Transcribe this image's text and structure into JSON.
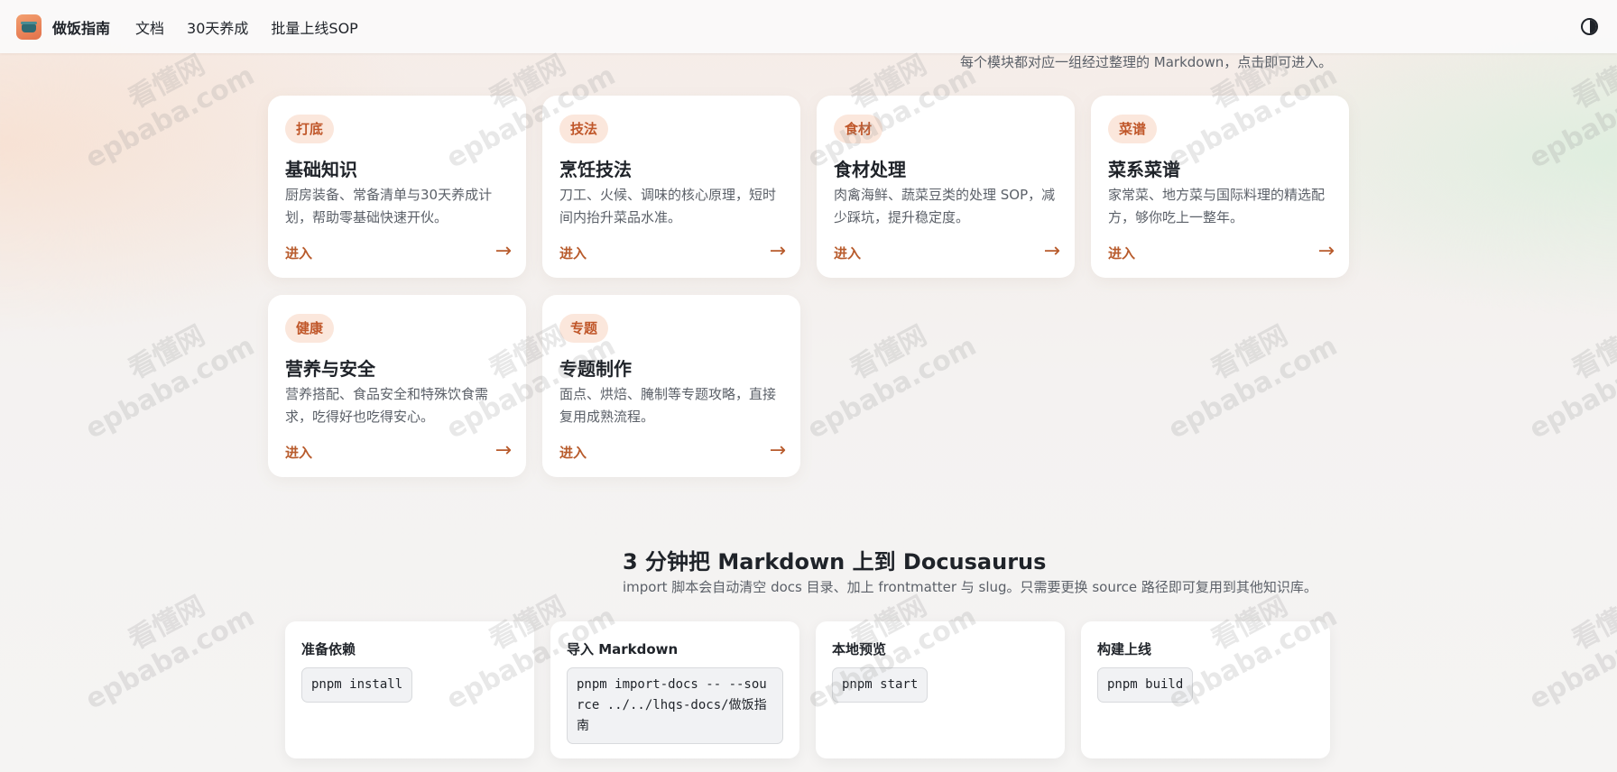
{
  "nav": {
    "brand": "做饭指南",
    "links": [
      "文档",
      "30天养成",
      "批量上线SOP"
    ]
  },
  "intro": "每个模块都对应一组经过整理的 Markdown，点击即可进入。",
  "cards": [
    {
      "tag": "打底",
      "title": "基础知识",
      "desc": "厨房装备、常备清单与30天养成计划，帮助零基础快速开伙。",
      "link": "进入",
      "arrow": "→"
    },
    {
      "tag": "技法",
      "title": "烹饪技法",
      "desc": "刀工、火候、调味的核心原理，短时间内抬升菜品水准。",
      "link": "进入",
      "arrow": "→"
    },
    {
      "tag": "食材",
      "title": "食材处理",
      "desc": "肉禽海鲜、蔬菜豆类的处理 SOP，减少踩坑，提升稳定度。",
      "link": "进入",
      "arrow": "→"
    },
    {
      "tag": "菜谱",
      "title": "菜系菜谱",
      "desc": "家常菜、地方菜与国际料理的精选配方，够你吃上一整年。",
      "link": "进入",
      "arrow": "→"
    },
    {
      "tag": "健康",
      "title": "营养与安全",
      "desc": "营养搭配、食品安全和特殊饮食需求，吃得好也吃得安心。",
      "link": "进入",
      "arrow": "→"
    },
    {
      "tag": "专题",
      "title": "专题制作",
      "desc": "面点、烘焙、腌制等专题攻略，直接复用成熟流程。",
      "link": "进入",
      "arrow": "→"
    }
  ],
  "section": {
    "title": "3 分钟把 Markdown 上到 Docusaurus",
    "subtitle": "import 脚本会自动清空 docs 目录、加上 frontmatter 与 slug。只需要更换 source 路径即可复用到其他知识库。"
  },
  "steps": [
    {
      "title": "准备依赖",
      "code": "pnpm install"
    },
    {
      "title": "导入 Markdown",
      "code": "pnpm import-docs -- --source ../../lhqs-docs/做饭指南"
    },
    {
      "title": "本地预览",
      "code": "pnpm start"
    },
    {
      "title": "构建上线",
      "code": "pnpm build"
    }
  ],
  "watermark": {
    "line1": "看懂网",
    "line2": "epbaba.com"
  },
  "colors": {
    "accent": "#b85b2c",
    "tag_bg": "#fbe7dc",
    "tag_text": "#c0572a"
  },
  "icons": {
    "logo": "cooking-pot-icon",
    "theme": "half-circle-contrast-icon"
  }
}
